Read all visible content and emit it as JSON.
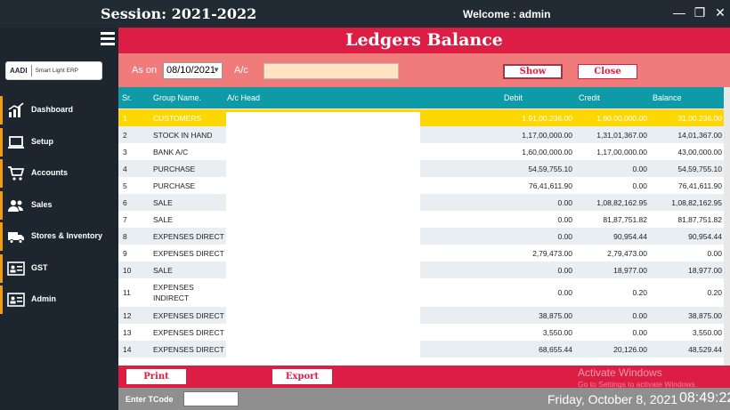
{
  "window": {
    "session": "Session: 2021-2022",
    "welcome": "Welcome : admin",
    "minimize": "—",
    "maximize": "❐",
    "close": "✕"
  },
  "sidebar": {
    "logo_mark": "AADI",
    "logo_text": "Smart Light ERP",
    "items": [
      {
        "label": "Dashboard",
        "icon": "chart-icon"
      },
      {
        "label": "Setup",
        "icon": "laptop-icon"
      },
      {
        "label": "Accounts",
        "icon": "cart-icon"
      },
      {
        "label": "Sales",
        "icon": "users-icon"
      },
      {
        "label": "Stores & Inventory",
        "icon": "truck-icon"
      },
      {
        "label": "GST",
        "icon": "id-card-icon"
      },
      {
        "label": "Admin",
        "icon": "id-card-icon"
      }
    ]
  },
  "page": {
    "title": "Ledgers Balance",
    "as_on_label": "As on",
    "as_on_value": "08/10/2021",
    "ac_label": "A/c",
    "ac_value": "",
    "show_label": "Show",
    "close_label": "Close"
  },
  "table": {
    "headers": {
      "sr": "Sr.",
      "group": "Group Name.",
      "head": "A/c Head",
      "debit": "Debit",
      "credit": "Credit",
      "balance": "Balance"
    },
    "rows": [
      {
        "sr": "1",
        "group": "CUSTOMERS",
        "debit": "1,91,00,236.00",
        "credit": "1,60,00,000.00",
        "balance": "31,00,236.00"
      },
      {
        "sr": "2",
        "group": "STOCK IN HAND",
        "debit": "1,17,00,000.00",
        "credit": "1,31,01,367.00",
        "balance": "14,01,367.00"
      },
      {
        "sr": "3",
        "group": "BANK A/C",
        "debit": "1,60,00,000.00",
        "credit": "1,17,00,000.00",
        "balance": "43,00,000.00"
      },
      {
        "sr": "4",
        "group": "PURCHASE",
        "debit": "54,59,755.10",
        "credit": "0.00",
        "balance": "54,59,755.10"
      },
      {
        "sr": "5",
        "group": "PURCHASE",
        "debit": "76,41,611.90",
        "credit": "0.00",
        "balance": "76,41,611.90"
      },
      {
        "sr": "6",
        "group": "SALE",
        "debit": "0.00",
        "credit": "1,08,82,162.95",
        "balance": "1,08,82,162.95"
      },
      {
        "sr": "7",
        "group": "SALE",
        "debit": "0.00",
        "credit": "81,87,751.82",
        "balance": "81,87,751.82"
      },
      {
        "sr": "8",
        "group": "EXPENSES DIRECT",
        "debit": "0.00",
        "credit": "90,954.44",
        "balance": "90,954.44"
      },
      {
        "sr": "9",
        "group": "EXPENSES DIRECT",
        "debit": "2,79,473.00",
        "credit": "2,79,473.00",
        "balance": "0.00"
      },
      {
        "sr": "10",
        "group": "SALE",
        "debit": "0.00",
        "credit": "18,977.00",
        "balance": "18,977.00"
      },
      {
        "sr": "11",
        "group": "EXPENSES INDIRECT",
        "debit": "0.00",
        "credit": "0.20",
        "balance": "0.20"
      },
      {
        "sr": "12",
        "group": "EXPENSES DIRECT",
        "debit": "38,875.00",
        "credit": "0.00",
        "balance": "38,875.00"
      },
      {
        "sr": "13",
        "group": "EXPENSES DIRECT",
        "debit": "3,550.00",
        "credit": "0.00",
        "balance": "3,550.00"
      },
      {
        "sr": "14",
        "group": "EXPENSES DIRECT",
        "debit": "68,655.44",
        "credit": "20,126.00",
        "balance": "48,529.44"
      }
    ]
  },
  "footer": {
    "print_label": "Print",
    "export_label": "Export",
    "watermark_title": "Activate Windows",
    "watermark_sub": "Go to Settings to activate Windows.",
    "tcode_label": "Enter TCode",
    "date": "Friday, October 8, 2021",
    "time": "08:49:22"
  },
  "colors": {
    "accent": "#dc1d44",
    "header_teal": "#0e9aa7",
    "selected": "#ffd700",
    "sidebar": "#1d262e",
    "nav_marker": "#f39c12"
  }
}
